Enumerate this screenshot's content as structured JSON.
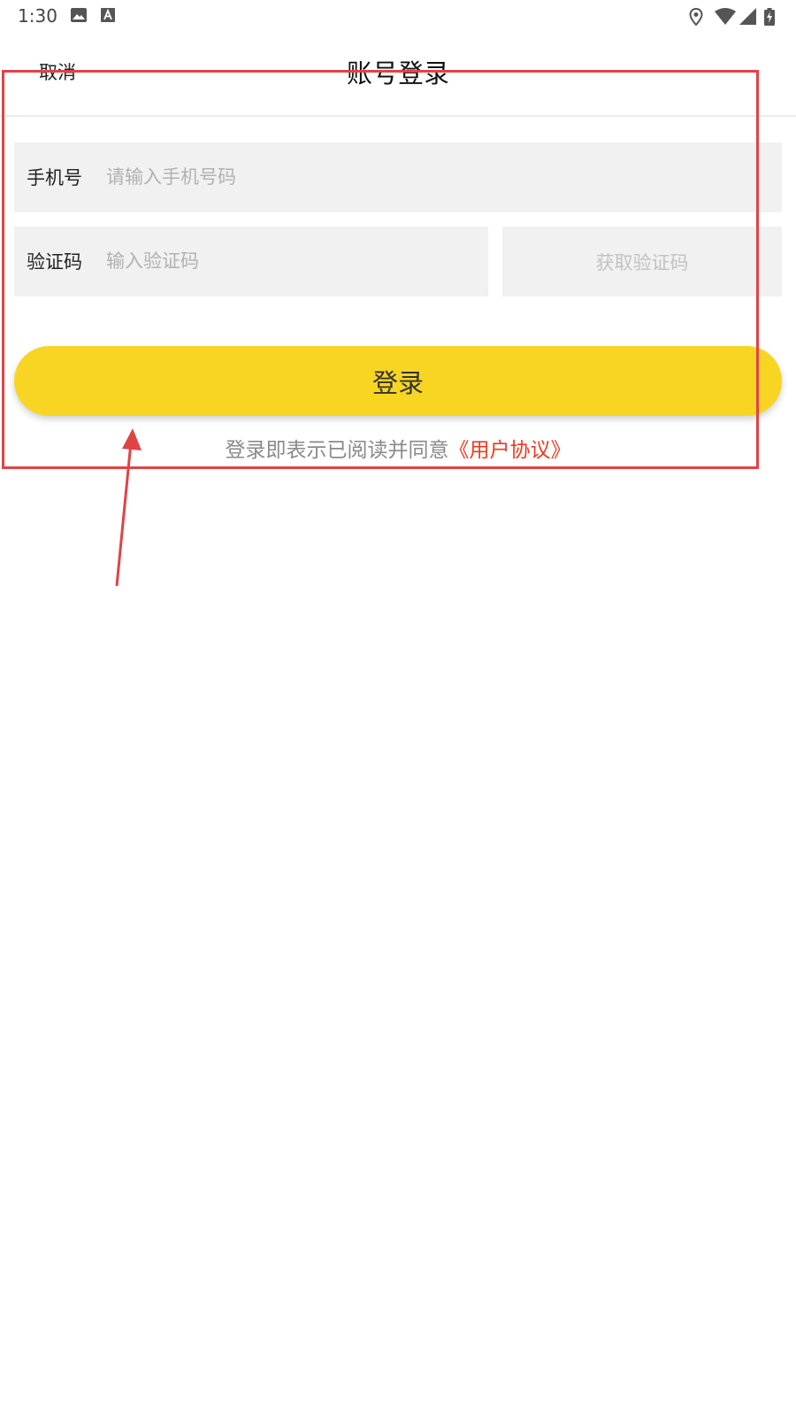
{
  "status_bar": {
    "time": "1:30",
    "icons": [
      "image-icon",
      "a-notification-icon",
      "location-icon",
      "wifi-icon",
      "signal-icon",
      "battery-icon"
    ]
  },
  "header": {
    "cancel_label": "取消",
    "title": "账号登录"
  },
  "form": {
    "phone_label": "手机号",
    "phone_placeholder": "请输入手机号码",
    "code_label": "验证码",
    "code_placeholder": "输入验证码",
    "get_code_label": "获取验证码",
    "login_label": "登录"
  },
  "agreement": {
    "text": "登录即表示已阅读并同意",
    "link": "《用户协议》"
  },
  "colors": {
    "accent": "#f8d523",
    "link": "#ee3b1f",
    "field_bg": "#f1f1f1",
    "annotation": "#e04346"
  }
}
